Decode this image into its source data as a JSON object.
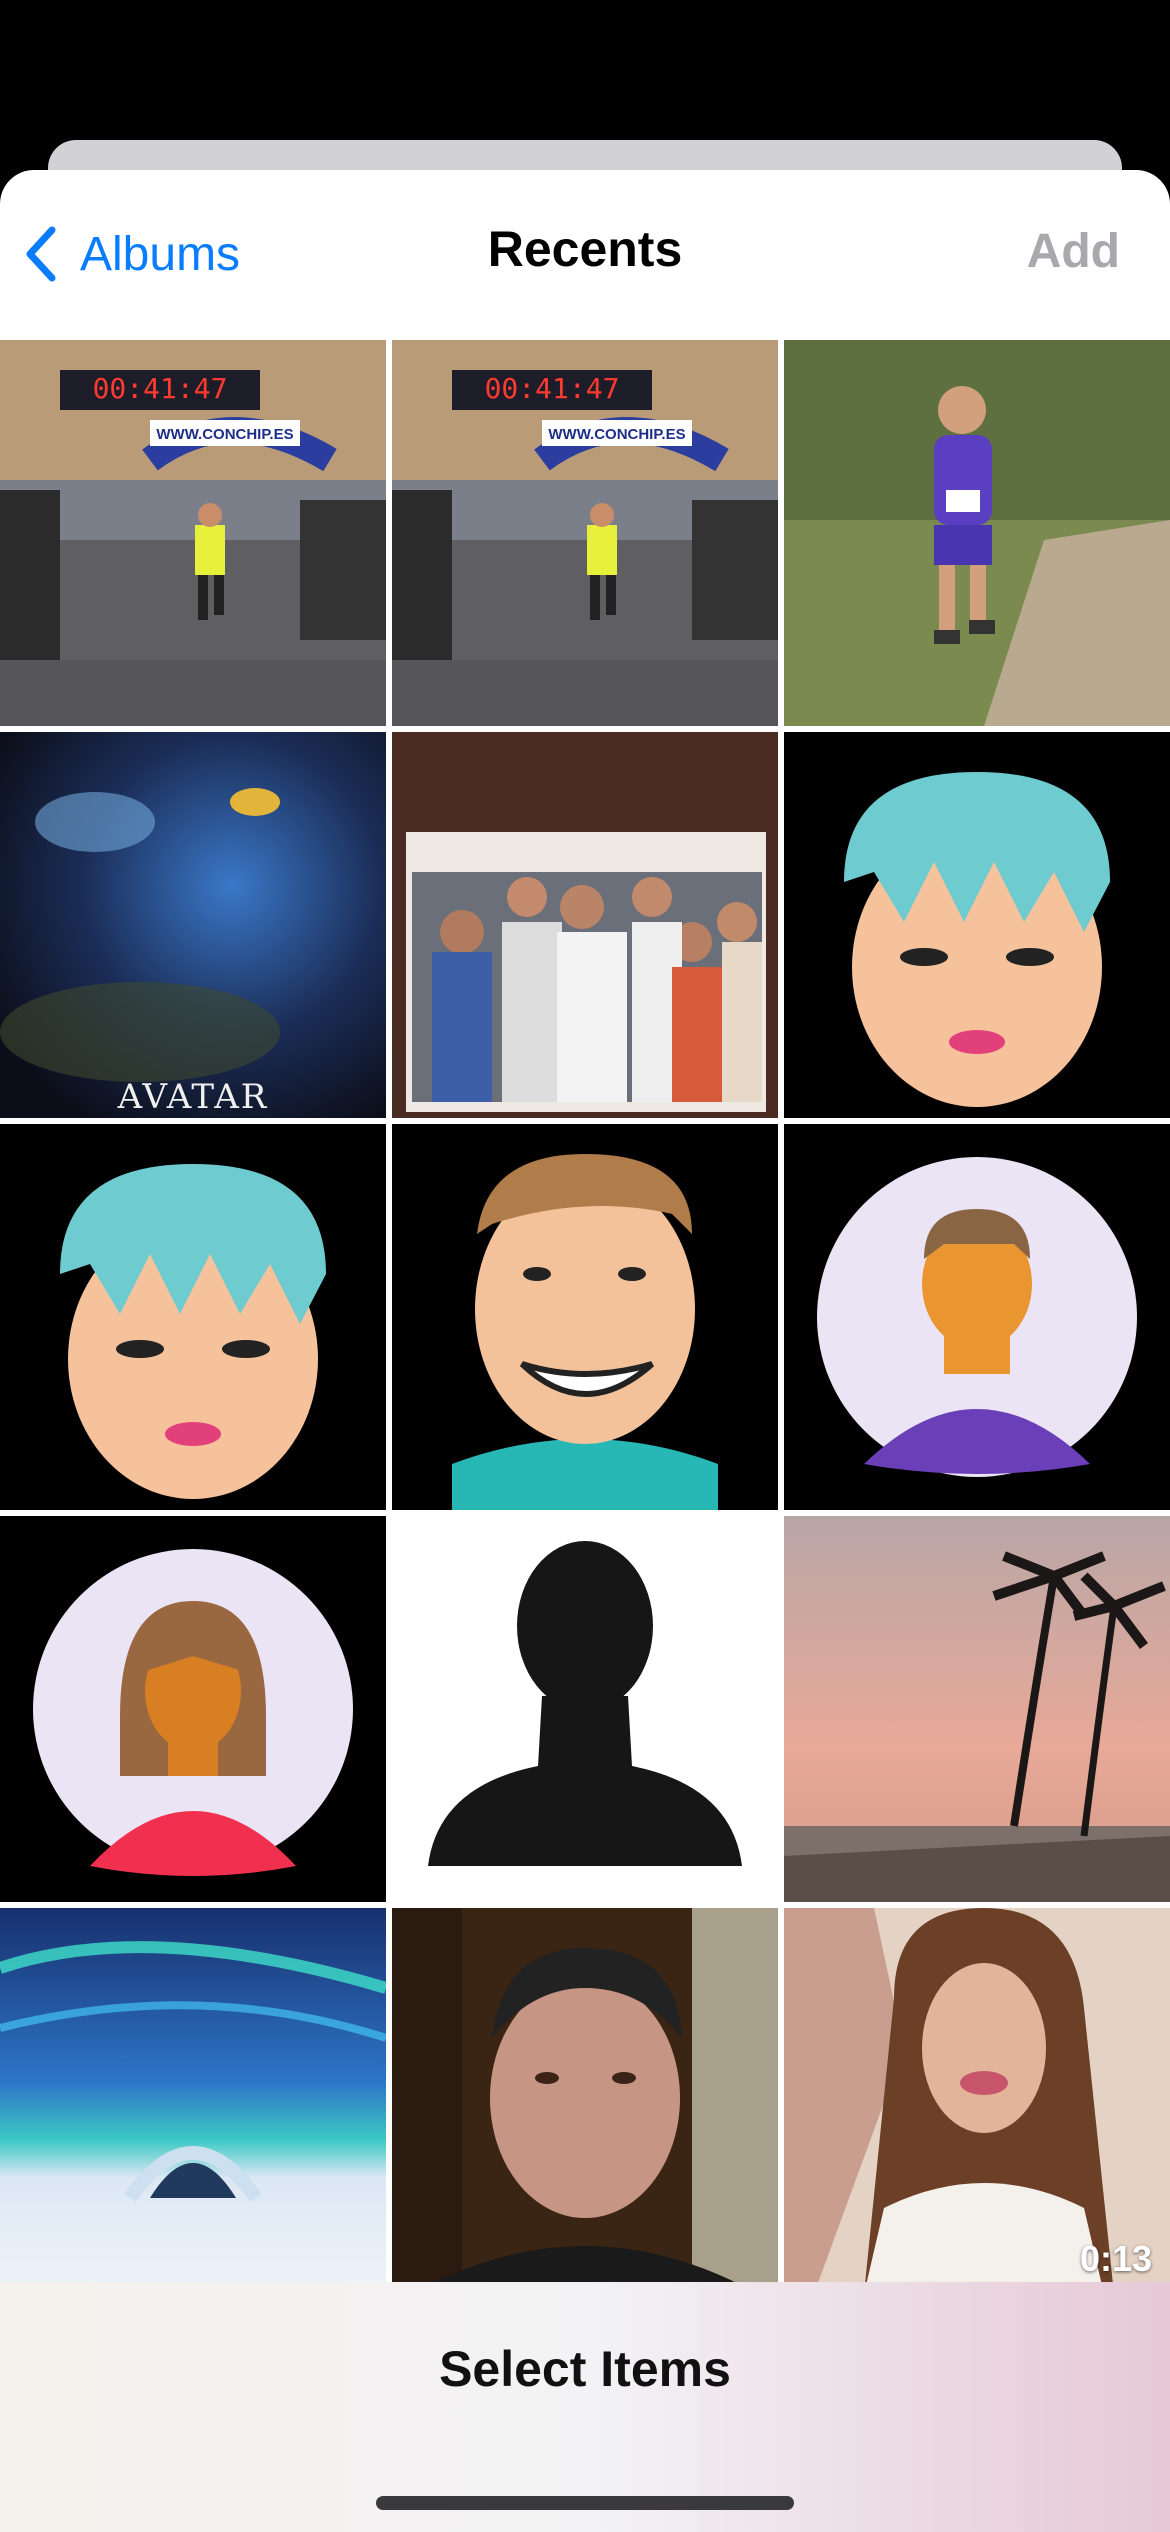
{
  "nav": {
    "back_label": "Albums",
    "title": "Recents",
    "add_label": "Add"
  },
  "photos": [
    {
      "subject": "race finish line with timer"
    },
    {
      "subject": "race finish line with timer"
    },
    {
      "subject": "trail runner in purple"
    },
    {
      "subject": "avatar movie poster"
    },
    {
      "subject": "family group photo"
    },
    {
      "subject": "pixel avatar teal hair"
    },
    {
      "subject": "pixel avatar teal hair"
    },
    {
      "subject": "pixel avatar smiling man"
    },
    {
      "subject": "pixel avatar boy circle"
    },
    {
      "subject": "pixel avatar woman circle"
    },
    {
      "subject": "default person silhouette"
    },
    {
      "subject": "palm trees sunset beach"
    },
    {
      "subject": "aurora over ice hotel"
    },
    {
      "subject": "man portrait indoors"
    },
    {
      "subject": "woman selfie video",
      "duration": "0:13"
    }
  ],
  "poster_text": "AVATAR",
  "banner_text": "WWW.CONCHIP.ES",
  "timer_text": "00:41:47",
  "toolbar": {
    "label": "Select Items"
  },
  "colors": {
    "accent": "#0a7cff",
    "disabled": "#a8a8ad"
  }
}
